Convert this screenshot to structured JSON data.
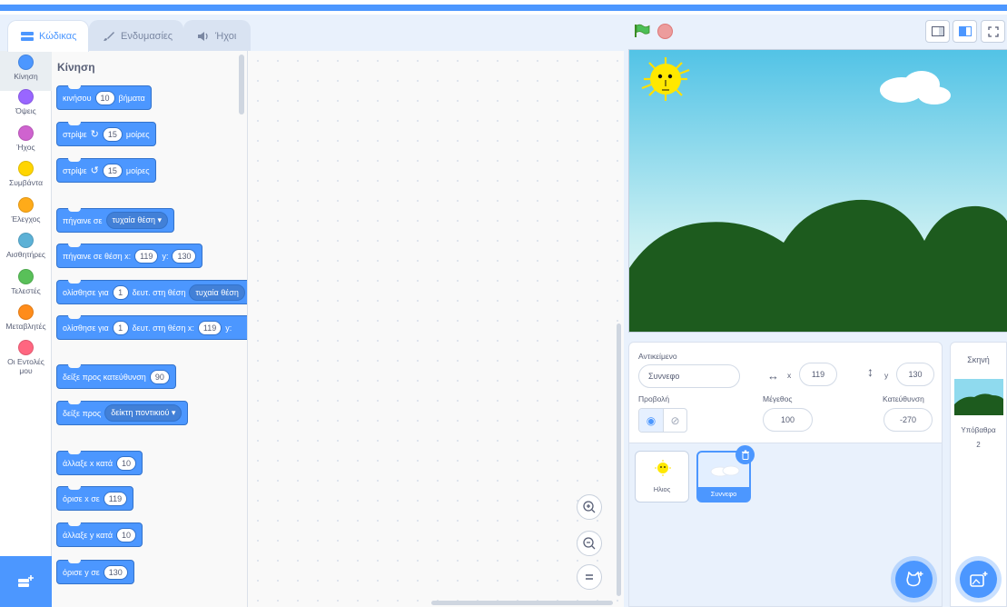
{
  "tabs": [
    {
      "label": "Κώδικας",
      "active": true
    },
    {
      "label": "Ενδυμασίες",
      "active": false
    },
    {
      "label": "Ήχοι",
      "active": false
    }
  ],
  "categories": [
    {
      "label": "Κίνηση",
      "color": "#4c97ff",
      "selected": true
    },
    {
      "label": "Όψεις",
      "color": "#9966ff"
    },
    {
      "label": "Ήχος",
      "color": "#cf63cf"
    },
    {
      "label": "Συμβάντα",
      "color": "#ffd500"
    },
    {
      "label": "Έλεγχος",
      "color": "#ffab19"
    },
    {
      "label": "Αισθητήρες",
      "color": "#5cb1d6"
    },
    {
      "label": "Τελεστές",
      "color": "#59c059"
    },
    {
      "label": "Μεταβλητές",
      "color": "#ff8c1a"
    },
    {
      "label": "Οι Εντολές μου",
      "color": "#ff6680"
    }
  ],
  "palette": {
    "title": "Κίνηση",
    "blocks": {
      "move": {
        "pre": "κινήσου",
        "val": "10",
        "post": "βήματα"
      },
      "turn_right": {
        "pre": "στρίψε",
        "icon": "rotate-right-icon",
        "val": "15",
        "post": "μοίρες"
      },
      "turn_left": {
        "pre": "στρίψε",
        "icon": "rotate-left-icon",
        "val": "15",
        "post": "μοίρες"
      },
      "goto": {
        "pre": "πήγαινε σε",
        "menu": "τυχαία θέση"
      },
      "goto_xy": {
        "pre": "πήγαινε σε θέση x:",
        "x": "119",
        "mid": "y:",
        "y": "130"
      },
      "glide_to": {
        "pre": "ολίσθησε για",
        "val": "1",
        "post": "δευτ. στη θέση",
        "menu": "τυχαία θέση"
      },
      "glide_xy": {
        "pre": "ολίσθησε για",
        "val": "1",
        "post": "δευτ. στη θέση x:",
        "x": "119",
        "mid": "y:"
      },
      "point_dir": {
        "pre": "δείξε προς κατεύθυνση",
        "val": "90"
      },
      "point_to": {
        "pre": "δείξε προς",
        "menu": "δείκτη ποντικιού"
      },
      "change_x": {
        "pre": "άλλαξε x κατά",
        "val": "10"
      },
      "set_x": {
        "pre": "όρισε x σε",
        "val": "119"
      },
      "change_y": {
        "pre": "άλλαξε y κατά",
        "val": "10"
      },
      "set_y": {
        "pre": "όρισε y σε",
        "val": "130"
      }
    }
  },
  "zoom": {
    "in_icon": "zoom-in-icon",
    "out_icon": "zoom-out-icon",
    "reset_icon": "zoom-reset-icon"
  },
  "sprite_info": {
    "sprite_label": "Αντικείμενο",
    "sprite_name": "Συννεφο",
    "x_label": "x",
    "x_value": "119",
    "y_label": "y",
    "y_value": "130",
    "show_label": "Προβολή",
    "size_label": "Μέγεθος",
    "size_value": "100",
    "direction_label": "Κατεύθυνση",
    "direction_value": "-270"
  },
  "sprites": [
    {
      "name": "Ηλιος",
      "selected": false
    },
    {
      "name": "Συννεφο",
      "selected": true
    }
  ],
  "stage_pane": {
    "title": "Σκηνή",
    "backdrops_label": "Υπόβαθρα",
    "backdrops_count": "2"
  },
  "colors": {
    "accent": "#4c97ff",
    "motion_block": "#4c97ff",
    "sky_top": "#5fc8e6",
    "sky_bottom": "#e4f8f5",
    "hills": "#1d5b1e",
    "sun": "#ffe800"
  }
}
